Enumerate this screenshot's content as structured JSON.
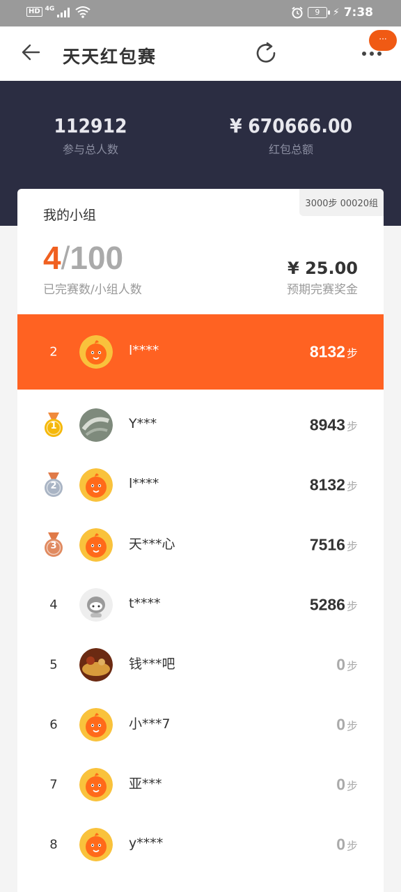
{
  "status_bar": {
    "hd": "HD",
    "network": "4G",
    "battery": "9",
    "time": "7:38"
  },
  "appbar": {
    "title": "天天红包赛",
    "notification_badge": "···"
  },
  "hero": {
    "participants_value": "112912",
    "participants_label": "参与总人数",
    "total_value": "¥ 670666.00",
    "total_label": "红包总额"
  },
  "group": {
    "tag": "3000步 00020组",
    "title": "我的小组",
    "completed": "4",
    "total": "100",
    "progress_label": "已完赛数/小组人数",
    "bonus_value": "¥ 25.00",
    "bonus_label": "预期完赛奖金"
  },
  "my_row": {
    "rank": "2",
    "name": "l****",
    "steps": "8132",
    "unit": "步"
  },
  "rows": [
    {
      "rank": "1",
      "medal": "gold",
      "name": "Y***",
      "steps": "8943",
      "unit": "步",
      "avatar": "photo-grey"
    },
    {
      "rank": "2",
      "medal": "silver",
      "name": "l****",
      "steps": "8132",
      "unit": "步",
      "avatar": "mascot"
    },
    {
      "rank": "3",
      "medal": "bronze",
      "name": "天***心",
      "steps": "7516",
      "unit": "步",
      "avatar": "mascot"
    },
    {
      "rank": "4",
      "medal": "",
      "name": "t****",
      "steps": "5286",
      "unit": "步",
      "avatar": "robot"
    },
    {
      "rank": "5",
      "medal": "",
      "name": "钱***吧",
      "steps": "0",
      "unit": "步",
      "avatar": "photo-food"
    },
    {
      "rank": "6",
      "medal": "",
      "name": "小***7",
      "steps": "0",
      "unit": "步",
      "avatar": "mascot"
    },
    {
      "rank": "7",
      "medal": "",
      "name": "亚***",
      "steps": "0",
      "unit": "步",
      "avatar": "mascot"
    },
    {
      "rank": "8",
      "medal": "",
      "name": "y****",
      "steps": "0",
      "unit": "步",
      "avatar": "mascot"
    }
  ],
  "colors": {
    "accent": "#ff6222",
    "hero_bg": "#2b2d42",
    "gold": "#f5b80a",
    "silver": "#a9b4c4",
    "bronze": "#e08a60"
  }
}
